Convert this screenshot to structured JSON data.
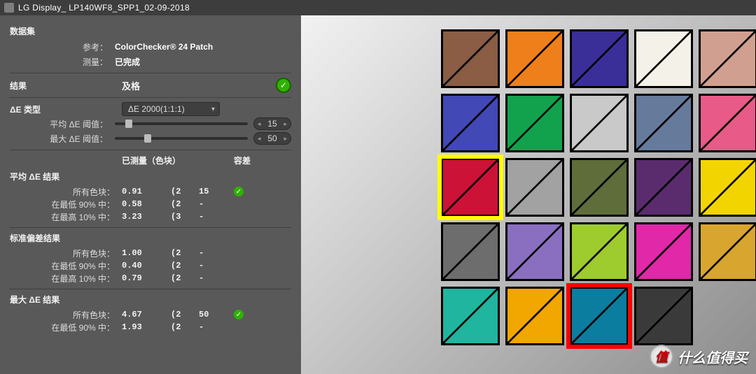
{
  "title": "LG Display_ LP140WF8_SPP1_02-09-2018",
  "dataset": {
    "heading": "数据集",
    "ref_label": "参考：",
    "ref_value": "ColorChecker® 24 Patch",
    "meas_label": "测量：",
    "meas_value": "已完成"
  },
  "result": {
    "heading": "结果",
    "value": "及格"
  },
  "de_type": {
    "label": "ΔE 类型",
    "value": "ΔE 2000(1:1:1)"
  },
  "sliders": {
    "avg_label": "平均 ΔE 阈值：",
    "avg_value": "15",
    "max_label": "最大 ΔE 阈值：",
    "max_value": "50"
  },
  "head": {
    "measured": "已测量（色块）",
    "tolerance": "容差"
  },
  "sections": {
    "avg": {
      "title": "平均 ΔE 结果",
      "rows": [
        {
          "label": "所有色块：",
          "v": "0.91",
          "n": "(2",
          "t": "15",
          "ok": true
        },
        {
          "label": "在最低 90% 中：",
          "v": "0.58",
          "n": "(2",
          "t": "-",
          "ok": false
        },
        {
          "label": "在最高 10% 中：",
          "v": "3.23",
          "n": "(3",
          "t": "-",
          "ok": false
        }
      ]
    },
    "std": {
      "title": "标准偏差结果",
      "rows": [
        {
          "label": "所有色块：",
          "v": "1.00",
          "n": "(2",
          "t": "-",
          "ok": false
        },
        {
          "label": "在最低 90% 中：",
          "v": "0.40",
          "n": "(2",
          "t": "-",
          "ok": false
        },
        {
          "label": "在最高 10% 中：",
          "v": "0.79",
          "n": "(2",
          "t": "-",
          "ok": false
        }
      ]
    },
    "max": {
      "title": "最大 ΔE 结果",
      "rows": [
        {
          "label": "所有色块：",
          "v": "4.67",
          "n": "(2",
          "t": "50",
          "ok": true
        },
        {
          "label": "在最低 90% 中：",
          "v": "1.93",
          "n": "(2",
          "t": "-",
          "ok": false
        }
      ]
    }
  },
  "patches": [
    {
      "c1": "#8a5d44",
      "c2": "#8a5d44"
    },
    {
      "c1": "#ef7f1a",
      "c2": "#ef7f1a"
    },
    {
      "c1": "#3a2e98",
      "c2": "#3a2e98"
    },
    {
      "c1": "#f3f1e8",
      "c2": "#f3f1e8"
    },
    {
      "c1": "#d19f8f",
      "c2": "#d19f8f"
    },
    {
      "c1": "#4248b5",
      "c2": "#4248b5"
    },
    {
      "c1": "#12a24e",
      "c2": "#12a24e"
    },
    {
      "c1": "#c9c9c9",
      "c2": "#c9c9c9"
    },
    {
      "c1": "#667a9c",
      "c2": "#667a9c"
    },
    {
      "c1": "#e85a88",
      "c2": "#e85a88"
    },
    {
      "c1": "#cc1237",
      "c2": "#cc1237",
      "sel": "y"
    },
    {
      "c1": "#a2a2a2",
      "c2": "#a2a2a2"
    },
    {
      "c1": "#5e6d3a",
      "c2": "#5e6d3a"
    },
    {
      "c1": "#5a2c6e",
      "c2": "#5a2c6e"
    },
    {
      "c1": "#f2d500",
      "c2": "#f2d500"
    },
    {
      "c1": "#6d6d6d",
      "c2": "#6d6d6d"
    },
    {
      "c1": "#8a6fc0",
      "c2": "#8a6fc0"
    },
    {
      "c1": "#9ecc2e",
      "c2": "#9ecc2e"
    },
    {
      "c1": "#e028a8",
      "c2": "#e028a8"
    },
    {
      "c1": "#d8a52e",
      "c2": "#d8a52e"
    },
    {
      "c1": "#1fb59e",
      "c2": "#1fb59e"
    },
    {
      "c1": "#f2a600",
      "c2": "#f2a600"
    },
    {
      "c1": "#0b7d9e",
      "c2": "#0b7d9e",
      "sel": "r"
    },
    {
      "c1": "#3a3a3a",
      "c2": "#3a3a3a"
    }
  ],
  "watermark": "什么值得买"
}
